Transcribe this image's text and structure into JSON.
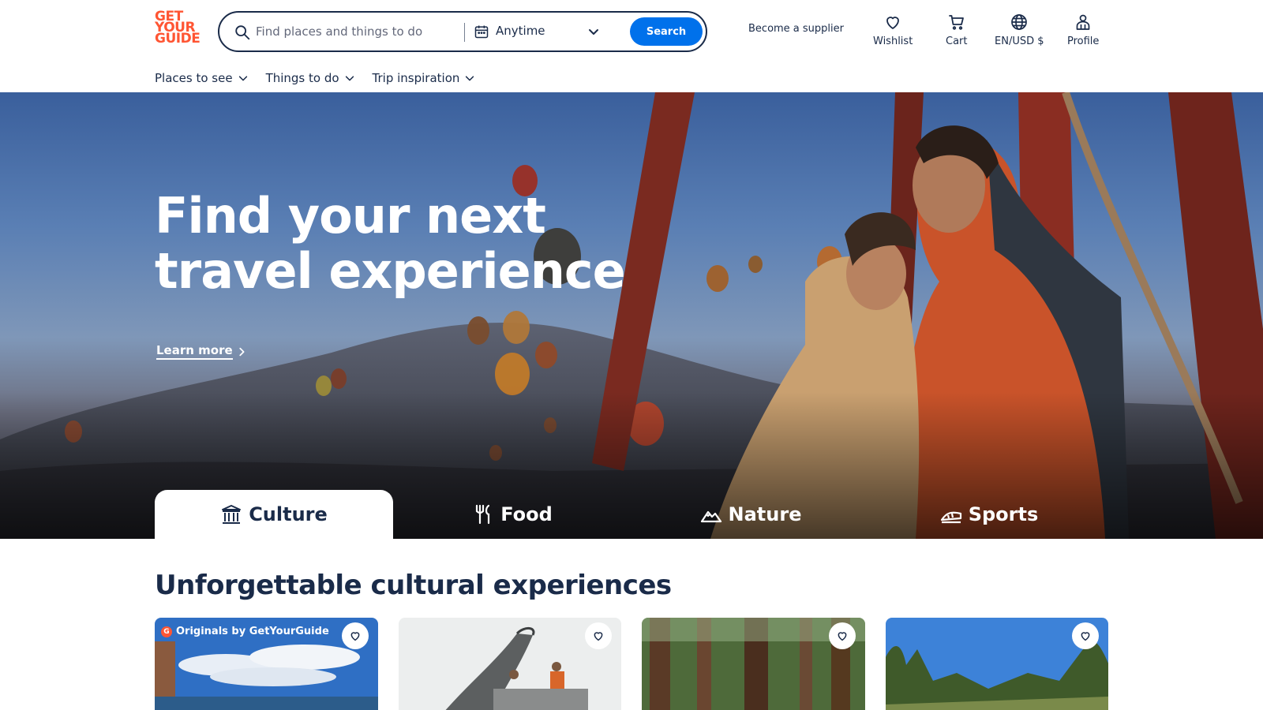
{
  "brand": {
    "logo_lines": [
      "GET",
      "YOUR",
      "GUIDE"
    ],
    "accent": "#ff5533",
    "primary": "#0071eb",
    "ink": "#1a2b49"
  },
  "search": {
    "placeholder": "Find places and things to do",
    "date_value": "Anytime",
    "button_label": "Search"
  },
  "header": {
    "supplier_link": "Become a supplier",
    "icons": [
      {
        "label": "Wishlist",
        "icon": "heart-icon"
      },
      {
        "label": "Cart",
        "icon": "cart-icon"
      },
      {
        "label": "EN/USD $",
        "icon": "globe-icon"
      },
      {
        "label": "Profile",
        "icon": "profile-icon"
      }
    ]
  },
  "subnav": [
    "Places to see",
    "Things to do",
    "Trip inspiration"
  ],
  "hero": {
    "title": "Find your next travel experience",
    "learn_more": "Learn more",
    "categories": [
      {
        "label": "Culture",
        "icon": "culture-icon",
        "active": true
      },
      {
        "label": "Food",
        "icon": "food-icon",
        "active": false
      },
      {
        "label": "Nature",
        "icon": "nature-icon",
        "active": false
      },
      {
        "label": "Sports",
        "icon": "sports-icon",
        "active": false
      }
    ]
  },
  "section": {
    "title": "Unforgettable cultural experiences",
    "cards": [
      {
        "badge": "Originals by GetYourGuide"
      },
      {
        "badge": ""
      },
      {
        "badge": ""
      },
      {
        "badge": ""
      }
    ]
  }
}
